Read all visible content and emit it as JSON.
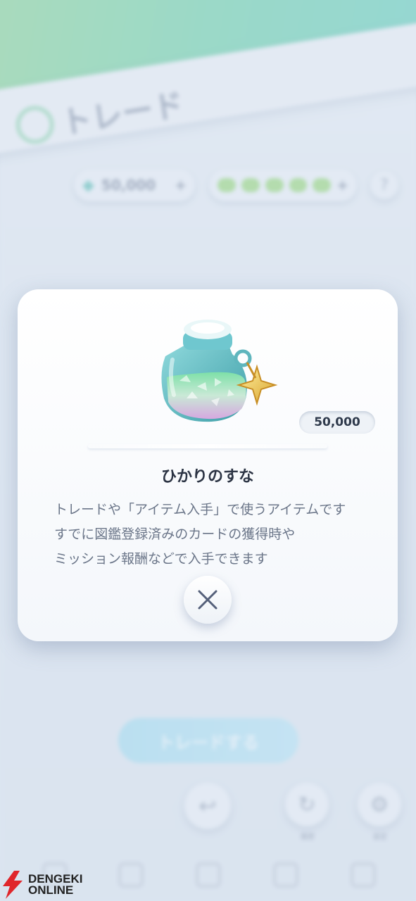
{
  "background": {
    "title": "トレード",
    "currency_amount": "50,000",
    "trade_button_label": "トレードする",
    "label_history": "履歴",
    "label_settings": "設定"
  },
  "modal": {
    "amount": "50,000",
    "item_name": "ひかりのすな",
    "description_lines": [
      "トレードや「アイテム入手」で使うアイテムです",
      "すでに図鑑登録済みのカードの獲得時や",
      "ミッション報酬などで入手できます"
    ]
  },
  "watermark": {
    "line1": "DENGEKI",
    "line2": "ONLINE"
  },
  "colors": {
    "header_gradient": "#78d3b2",
    "modal_bg": "#ffffff",
    "text_dark": "#2c3444",
    "text_desc": "#6b7689"
  }
}
